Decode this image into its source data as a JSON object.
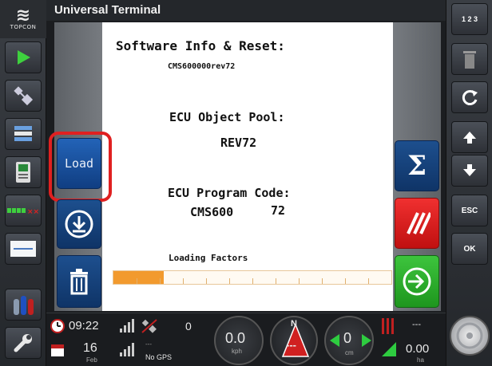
{
  "title": "Universal Terminal",
  "logo": {
    "brand": "TOPCON"
  },
  "content": {
    "heading": "Software Info & Reset:",
    "sw_version": "CMS600000rev72",
    "pool_label": "ECU Object Pool:",
    "pool_value": "REV72",
    "program_label": "ECU Program Code:",
    "program_name": "CMS600",
    "program_rev": "72",
    "loading_label": "Loading Factors",
    "loading_progress": 0.18
  },
  "soft_keys_left": {
    "load_label": "Load"
  },
  "right_bar": {
    "top_label": "1 2 3",
    "esc_label": "ESC",
    "ok_label": "OK"
  },
  "status": {
    "time": "09:22",
    "day": "16",
    "month": "Feb",
    "count": "0",
    "gps": "No GPS",
    "gps_dash": "---",
    "speed": "0.0",
    "speed_unit": "kph",
    "heading_letter": "N",
    "heading_value": "---",
    "offset": "0",
    "offset_unit": "cm",
    "area_dash": "---",
    "area": "0.00",
    "area_unit": "ha"
  },
  "colors": {
    "accent_blue": "#1d4f8e",
    "progress": "#f29a2e",
    "highlight": "#e02020"
  }
}
